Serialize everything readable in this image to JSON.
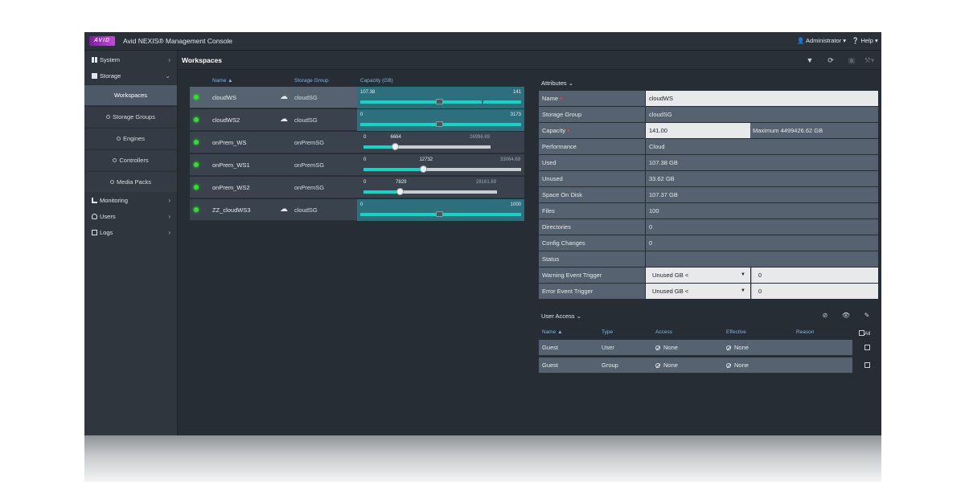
{
  "app": {
    "logo_text": "AVID",
    "title": "Avid NEXIS® Management Console",
    "user_menu": "Administrator",
    "help_menu": "Help"
  },
  "sidebar": {
    "system": "System",
    "storage": "Storage",
    "storage_items": [
      "Workspaces",
      "Storage Groups",
      "Engines",
      "Controllers",
      "Media Packs"
    ],
    "monitoring": "Monitoring",
    "users": "Users",
    "logs": "Logs"
  },
  "main": {
    "title": "Workspaces"
  },
  "workspaces": {
    "headers": {
      "name": "Name",
      "storage_group": "Storage Group",
      "capacity": "Capacity (GB)"
    },
    "rows": [
      {
        "name": "cloudWS",
        "storage_group": "cloudSG",
        "cloud": true,
        "low": "107.38",
        "high": "141"
      },
      {
        "name": "cloudWS2",
        "storage_group": "cloudSG",
        "cloud": true,
        "low": "0",
        "high": "3173"
      },
      {
        "name": "onPrem_WS",
        "storage_group": "onPremSG",
        "cloud": false,
        "low": "0",
        "current": "6664",
        "max": "26996.69",
        "fraction": 0.25
      },
      {
        "name": "onPrem_WS1",
        "storage_group": "onPremSG",
        "cloud": false,
        "low": "0",
        "current": "12732",
        "max": "33064.69",
        "fraction": 0.385
      },
      {
        "name": "onPrem_WS2",
        "storage_group": "onPremSG",
        "cloud": false,
        "low": "0",
        "current": "7829",
        "max": "28161.69",
        "fraction": 0.278
      },
      {
        "name": "ZZ_cloudWS3",
        "storage_group": "cloudSG",
        "cloud": true,
        "low": "0",
        "high": "1000"
      }
    ]
  },
  "attributes": {
    "header": "Attributes",
    "rows": [
      {
        "label": "Name",
        "value": "cloudWS"
      },
      {
        "label": "Storage Group",
        "value": "cloudSG"
      },
      {
        "label": "Capacity",
        "value": "141.00",
        "extra": "Maximum 4499426.62 GB"
      },
      {
        "label": "Performance",
        "value": "Cloud"
      },
      {
        "label": "Used",
        "value": "107.38 GB"
      },
      {
        "label": "Unused",
        "value": "33.62 GB"
      },
      {
        "label": "Space On Disk",
        "value": "107.37 GB"
      },
      {
        "label": "Files",
        "value": "100"
      },
      {
        "label": "Directories",
        "value": "0"
      },
      {
        "label": "Config Changes",
        "value": "0"
      },
      {
        "label": "Status",
        "value": ""
      },
      {
        "label": "Warning Event Trigger",
        "value": "Unused GB <",
        "extra": "0"
      },
      {
        "label": "Error Event Trigger",
        "value": "Unused GB <",
        "extra": "0"
      }
    ]
  },
  "user_access": {
    "header": "User Access",
    "headers": {
      "name": "Name",
      "type": "Type",
      "access": "Access",
      "effective": "Effective",
      "reason": "Reason",
      "all": "All"
    },
    "rows": [
      {
        "name": "Guest",
        "type": "User",
        "access": "None",
        "effective": "None"
      },
      {
        "name": "Guest",
        "type": "Group",
        "access": "None",
        "effective": "None"
      }
    ]
  },
  "colors": {
    "accent": "#17d3c6",
    "status_online": "#2fe02f",
    "selection": "#56626f",
    "header_link": "#7fb7dd",
    "logo": "#c64bd6"
  },
  "icons": {
    "toolbar": [
      "filter-icon",
      "refresh-icon",
      "save-icon",
      "wrench-icon",
      "copy-icon",
      "plus-icon",
      "sync-icon",
      "edit-icon"
    ],
    "user_access": [
      "block-icon",
      "eye-icon",
      "pencil-icon"
    ]
  }
}
